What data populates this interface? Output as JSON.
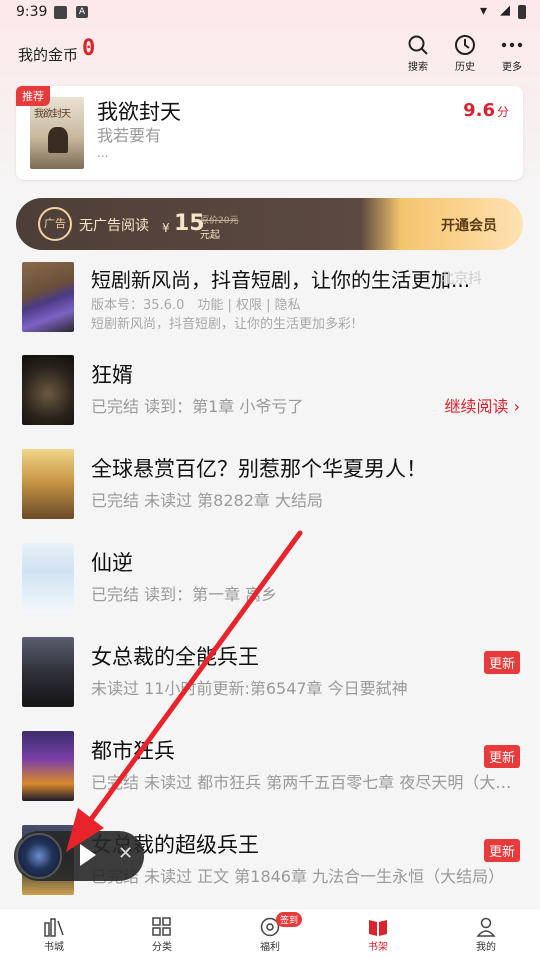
{
  "status_bar": {
    "time": "9:39"
  },
  "header": {
    "coin_label": "我的金币",
    "coin_value": "0",
    "buttons": [
      {
        "label": "搜索",
        "icon": "search-icon"
      },
      {
        "label": "历史",
        "icon": "clock-icon"
      },
      {
        "label": "更多",
        "icon": "more-icon"
      }
    ]
  },
  "recommend": {
    "badge": "推荐",
    "cover_text": "我欲封天",
    "title": "我欲封天",
    "subtitle": "我若要有",
    "ellipsis": "...",
    "score": "9.6",
    "score_unit": "分"
  },
  "vip_banner": {
    "icon_text": "广告",
    "text": "无广告阅读",
    "currency": "¥",
    "price": "15",
    "original": "原价20元",
    "from": "元起",
    "action": "开通会员"
  },
  "ad_item": {
    "title": "短剧新风尚，抖音短剧，让你的生活更加...",
    "ghost": "北京抖",
    "meta": "版本号：35.6.0　功能 | 权限 | 隐私",
    "desc": "短剧新风尚，抖音短剧，让你的生活更加多彩!"
  },
  "books": [
    {
      "title": "狂婿",
      "info": "已完结 读到：第1章 小爷亏了",
      "action": "继续阅读 ›",
      "badge": ""
    },
    {
      "title": "全球悬赏百亿？别惹那个华夏男人！",
      "info": "已完结 未读过 第8282章 大结局",
      "action": "",
      "badge": ""
    },
    {
      "title": "仙逆",
      "info": "已完结 读到：第一章 离乡",
      "action": "",
      "badge": ""
    },
    {
      "title": "女总裁的全能兵王",
      "info": "未读过 11小时前更新:第6547章 今日要弑神",
      "action": "",
      "badge": "更新"
    },
    {
      "title": "都市狂兵",
      "info": "已完结 未读过 都市狂兵 第两千五百零七章 夜尽天明（大结局）",
      "action": "",
      "badge": "更新"
    },
    {
      "title": "女总裁的超级兵王",
      "info": "已完结 未读过 正文 第1846章 九法合一生永恒（大结局）",
      "action": "",
      "badge": "更新"
    }
  ],
  "bottom_nav": [
    {
      "label": "书城",
      "icon": "bookstore-icon"
    },
    {
      "label": "分类",
      "icon": "category-icon"
    },
    {
      "label": "福利",
      "icon": "welfare-icon"
    },
    {
      "label": "书架",
      "icon": "bookshelf-icon"
    },
    {
      "label": "我的",
      "icon": "profile-icon"
    }
  ],
  "sign_badge": "签到",
  "colors": {
    "accent": "#d9232d",
    "badge": "#e83a3a"
  }
}
